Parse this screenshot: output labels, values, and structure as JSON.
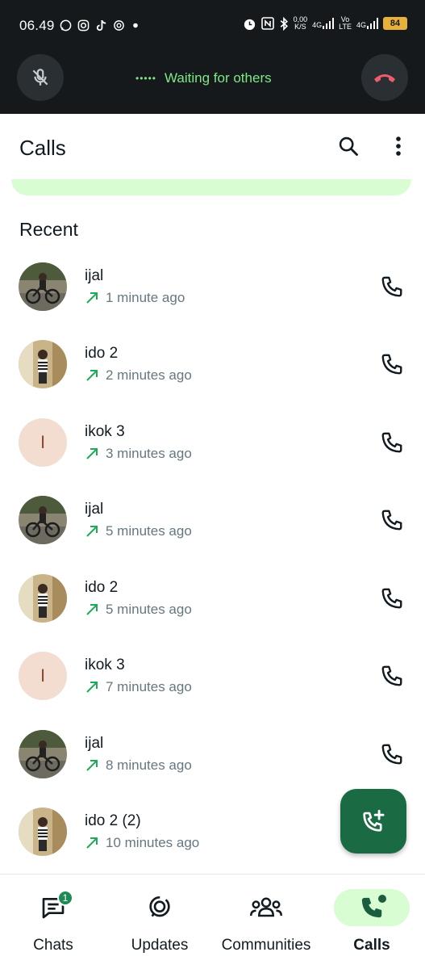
{
  "status_bar": {
    "time": "06.49",
    "data_speed_value": "0,00",
    "data_speed_unit": "K/S",
    "network1": "4G",
    "volte_top": "Vo",
    "volte_bottom": "LTE",
    "network2": "4G",
    "battery": "84"
  },
  "call_banner": {
    "status": "Waiting for others",
    "mute_icon": "mic-off-icon",
    "end_icon": "end-call-icon"
  },
  "app_bar": {
    "title": "Calls",
    "search_icon": "search-icon",
    "menu_icon": "more-vert-icon"
  },
  "section": {
    "recent_label": "Recent"
  },
  "calls": [
    {
      "name": "ijal",
      "time": "1 minute ago",
      "avatar": "photo-bike"
    },
    {
      "name": "ido 2",
      "time": "2 minutes ago",
      "avatar": "photo-room"
    },
    {
      "name": "ikok 3",
      "time": "3 minutes ago",
      "avatar": "letter",
      "initial": "I"
    },
    {
      "name": "ijal",
      "time": "5 minutes ago",
      "avatar": "photo-bike"
    },
    {
      "name": "ido 2",
      "time": "5 minutes ago",
      "avatar": "photo-room"
    },
    {
      "name": "ikok 3",
      "time": "7 minutes ago",
      "avatar": "letter",
      "initial": "I"
    },
    {
      "name": "ijal",
      "time": "8 minutes ago",
      "avatar": "photo-bike"
    },
    {
      "name": "ido 2 (2)",
      "time": "10 minutes ago",
      "avatar": "photo-room"
    }
  ],
  "fab": {
    "icon": "add-call-icon"
  },
  "bottom_nav": [
    {
      "label": "Chats",
      "icon": "chat-icon",
      "badge": "1"
    },
    {
      "label": "Updates",
      "icon": "updates-icon"
    },
    {
      "label": "Communities",
      "icon": "communities-icon"
    },
    {
      "label": "Calls",
      "icon": "call-icon",
      "active": true
    }
  ],
  "colors": {
    "accent_green": "#1a6b44",
    "light_green": "#d8fdd2",
    "outgoing_arrow": "#1faa5a",
    "end_call_red": "#f15c6d",
    "waiting_text": "#7ee787"
  }
}
